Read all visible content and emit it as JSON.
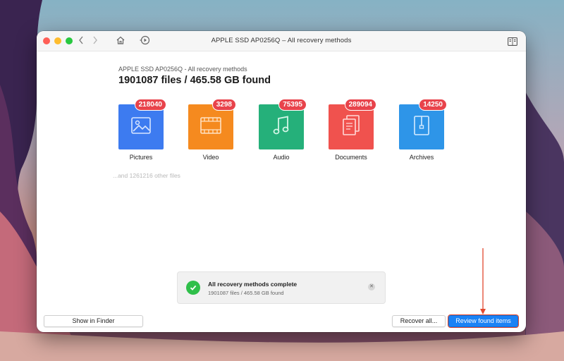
{
  "window": {
    "title": "APPLE SSD AP0256Q – All recovery methods"
  },
  "toolbar": {
    "back_icon": "chevron-left-icon",
    "forward_icon": "chevron-right-icon",
    "home_icon": "home-icon",
    "scan_icon": "scan-icon",
    "sidebar_icon": "book-icon"
  },
  "summary": {
    "subtitle": "APPLE SSD AP0256Q - All recovery methods",
    "headline": "1901087 files / 465.58 GB found"
  },
  "categories": [
    {
      "label": "Pictures",
      "count": "218040",
      "color": "#3d7bf0",
      "icon": "picture-icon"
    },
    {
      "label": "Video",
      "count": "3298",
      "color": "#f58a1f",
      "icon": "film-icon"
    },
    {
      "label": "Audio",
      "count": "75395",
      "color": "#25b07a",
      "icon": "music-note-icon"
    },
    {
      "label": "Documents",
      "count": "289094",
      "color": "#f0524e",
      "icon": "document-icon"
    },
    {
      "label": "Archives",
      "count": "14250",
      "color": "#2e95e8",
      "icon": "archive-icon"
    }
  ],
  "other_files": "...and 1261216 other files",
  "toast": {
    "title": "All recovery methods complete",
    "detail": "1901087 files / 465.58 GB found"
  },
  "buttons": {
    "show_in_finder": "Show in Finder",
    "recover_all": "Recover all...",
    "review_found_items": "Review found items"
  },
  "colors": {
    "accent": "#1a82f5",
    "badge": "#e8434b",
    "highlight": "#e2492f",
    "success": "#2fbf4a"
  }
}
